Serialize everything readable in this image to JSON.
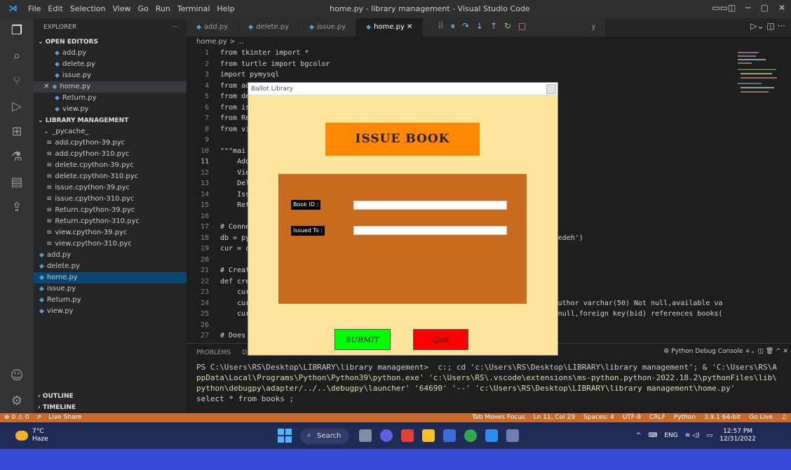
{
  "titlebar": {
    "menus": [
      "File",
      "Edit",
      "Selection",
      "View",
      "Go",
      "Run",
      "Terminal",
      "Help"
    ],
    "title": "home.py - library management - Visual Studio Code"
  },
  "sidebar": {
    "title": "EXPLORER",
    "open_editors_label": "OPEN EDITORS",
    "open_editors": [
      "add.py",
      "delete.py",
      "issue.py",
      "home.py",
      "Return.py",
      "view.py"
    ],
    "project_label": "LIBRARY MANAGEMENT",
    "pycache": "_pycache_",
    "pycache_files": [
      "add.cpython-39.pyc",
      "add.cpython-310.pyc",
      "delete.cpython-39.pyc",
      "delete.cpython-310.pyc",
      "issue.cpython-39.pyc",
      "issue.cpython-310.pyc",
      "Return.cpython-39.pyc",
      "Return.cpython-310.pyc",
      "view.cpython-39.pyc",
      "view.cpython-310.pyc"
    ],
    "files": [
      "add.py",
      "delete.py",
      "home.py",
      "issue.py",
      "Return.py",
      "view.py"
    ],
    "outline": "OUTLINE",
    "timeline": "TIMELINE"
  },
  "tabs": [
    "add.py",
    "delete.py",
    "issue.py",
    "home.py"
  ],
  "tab_partial": "y",
  "breadcrumb": "home.py > ...",
  "code_lines": [
    [
      "1",
      "from tkinter import *"
    ],
    [
      "2",
      "from turtle import bgcolor"
    ],
    [
      "3",
      "import pymysql"
    ],
    [
      "4",
      "from add import *"
    ],
    [
      "5",
      "from de"
    ],
    [
      "6",
      "from is"
    ],
    [
      "7",
      "from Re"
    ],
    [
      "8",
      "from vi"
    ],
    [
      "9",
      ""
    ],
    [
      "10",
      "\"\"\"mai"
    ],
    [
      "11",
      "    Add"
    ],
    [
      "12",
      "    Vie"
    ],
    [
      "13",
      "    Del"
    ],
    [
      "14",
      "    Iss"
    ],
    [
      "15",
      "    Ret"
    ],
    [
      "16",
      ""
    ],
    [
      "17",
      "# Conne"
    ],
    [
      "18",
      "db = py                                                                      'maedeh')"
    ],
    [
      "19",
      "cur = c"
    ],
    [
      "20",
      ""
    ],
    [
      "21",
      "# Creat"
    ],
    [
      "22",
      "def cre"
    ],
    [
      "23",
      "    cur"
    ],
    [
      "24",
      "    cur                                                                   null,author varchar(50) Not null,available va"
    ],
    [
      "25",
      "    cur                                                                  0) Not null,foreign key(bid) references books("
    ],
    [
      "26",
      ""
    ],
    [
      "27",
      "# Does"
    ],
    [
      "28",
      "# If it"
    ],
    [
      "29",
      "def ful"
    ],
    [
      "30",
      "    cur"
    ]
  ],
  "panel": {
    "tabs": [
      "PROBLEMS",
      "DEBUG"
    ],
    "console_label": "Python Debug Console",
    "terminal": [
      "PS C:\\Users\\RS\\Desktop\\LIBRARY\\library management>  c:; cd 'c:\\Users\\RS\\Desktop\\LIBRARY\\library management'; & 'C:\\Users\\RS\\A",
      "ppData\\Local\\Programs\\Python\\Python39\\python.exe' 'c:\\Users\\RS\\.vscode\\extensions\\ms-python.python-2022.18.2\\pythonFiles\\lib\\",
      "python\\debugpy\\adapter/../..\\debugpy\\launcher' '64690' '--' 'c:\\Users\\RS\\Desktop\\LIBRARY\\library management\\home.py'",
      "select * from books ;"
    ]
  },
  "statusbar": {
    "left": [
      "⊗ 0 ⚠ 0",
      "Live Share"
    ],
    "right": [
      "Tab Moves Focus",
      "Ln 11, Col 29",
      "Spaces: 4",
      "UTF-8",
      "CRLF",
      "Python",
      "3.9.1 64-bit",
      "Go Live"
    ]
  },
  "taskbar": {
    "temp": "7°C",
    "condition": "Haze",
    "search": "Search",
    "lang": "ENG",
    "time": "12:57 PM",
    "date": "12/31/2022"
  },
  "dialog": {
    "title": "Ballot Library",
    "heading": "ISSUE BOOK",
    "book_id_label": "Book ID :",
    "issued_to_label": "Issued To :",
    "book_id_value": "",
    "issued_to_value": "",
    "submit": "SUBMIT",
    "quit": "Quit"
  },
  "colors": {
    "dialog_bg": "#fde59b",
    "heading_bg": "#ff8800",
    "form_bg": "#c96b1e",
    "submit_bg": "#00ff00",
    "quit_bg": "#ff0000",
    "statusbar": "#c66b2b"
  }
}
